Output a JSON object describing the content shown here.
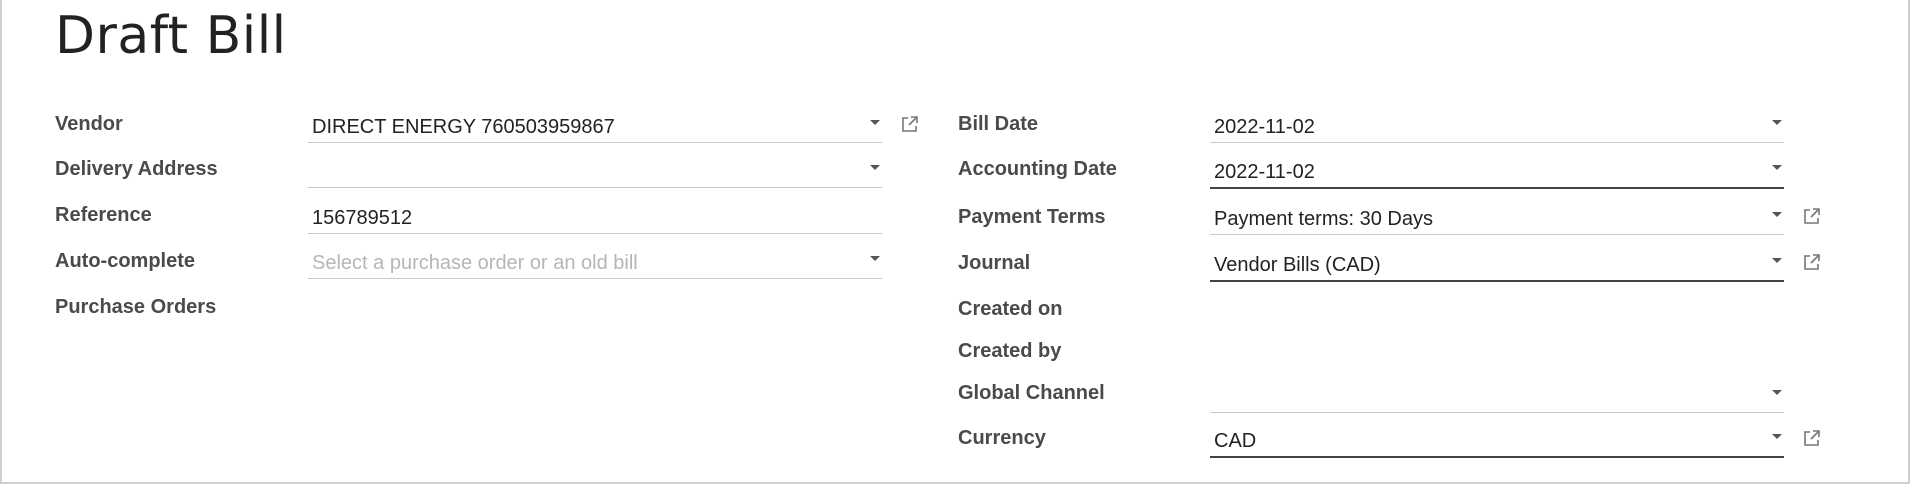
{
  "page": {
    "title": "Draft Bill"
  },
  "left_fields": {
    "vendor": {
      "label": "Vendor",
      "value": "DIRECT ENERGY 760503959867"
    },
    "delivery_address": {
      "label": "Delivery Address",
      "value": ""
    },
    "reference": {
      "label": "Reference",
      "value": "156789512"
    },
    "auto_complete": {
      "label": "Auto-complete",
      "value": "",
      "placeholder": "Select a purchase order or an old bill"
    },
    "purchase_orders": {
      "label": "Purchase Orders"
    }
  },
  "right_fields": {
    "bill_date": {
      "label": "Bill Date",
      "value": "2022-11-02"
    },
    "accounting_date": {
      "label": "Accounting Date",
      "value": "2022-11-02"
    },
    "payment_terms": {
      "label": "Payment Terms",
      "value": "Payment terms: 30 Days"
    },
    "journal": {
      "label": "Journal",
      "value": "Vendor Bills (CAD)"
    },
    "created_on": {
      "label": "Created on"
    },
    "created_by": {
      "label": "Created by"
    },
    "global_channel": {
      "label": "Global Channel",
      "value": ""
    },
    "currency": {
      "label": "Currency",
      "value": "CAD"
    }
  },
  "icons": {
    "dropdown": "chevron-down-icon",
    "external_link": "external-link-icon"
  }
}
